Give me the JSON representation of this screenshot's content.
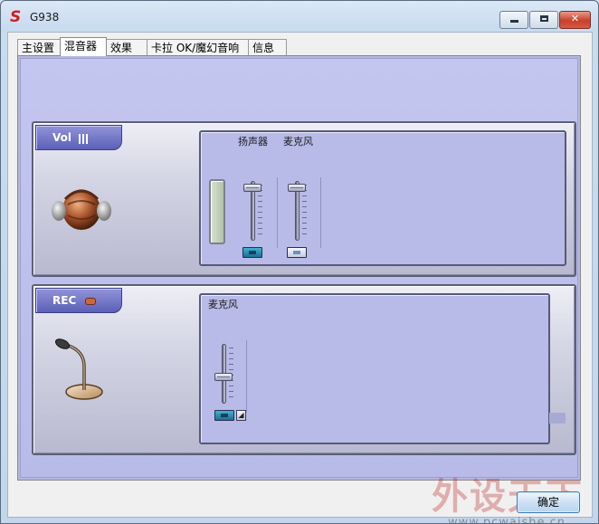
{
  "window": {
    "title": "G938",
    "logo_letter": "S",
    "controls": {
      "minimize": "minimize",
      "maximize": "maximize",
      "close": "✕"
    }
  },
  "tabs": [
    {
      "label": "主设置",
      "active": false
    },
    {
      "label": "混音器",
      "active": true
    },
    {
      "label": "效果",
      "active": false
    },
    {
      "label": "卡拉 OK/魔幻音响",
      "active": false
    },
    {
      "label": "信息",
      "active": false
    }
  ],
  "playback": {
    "section_label": "Vol",
    "icon": "speaker-headphones-icon",
    "channels": [
      {
        "label": "扬声器",
        "level": 0.95,
        "mute_active": true
      },
      {
        "label": "麦克风",
        "level": 0.95,
        "mute_active": false
      }
    ]
  },
  "record": {
    "section_label": "REC",
    "icon": "microphone-icon",
    "channels": [
      {
        "label": "麦克风",
        "level": 0.45,
        "mute_active": true
      }
    ]
  },
  "footer": {
    "ok_label": "确定"
  },
  "watermark": {
    "text": "外设天下",
    "url": "www.pcwaishe.cn"
  },
  "colors": {
    "panel": "#b8bbe8",
    "section_label": "#6064bb",
    "close_button": "#c8402b",
    "mute_on": "#2aa1c4"
  }
}
